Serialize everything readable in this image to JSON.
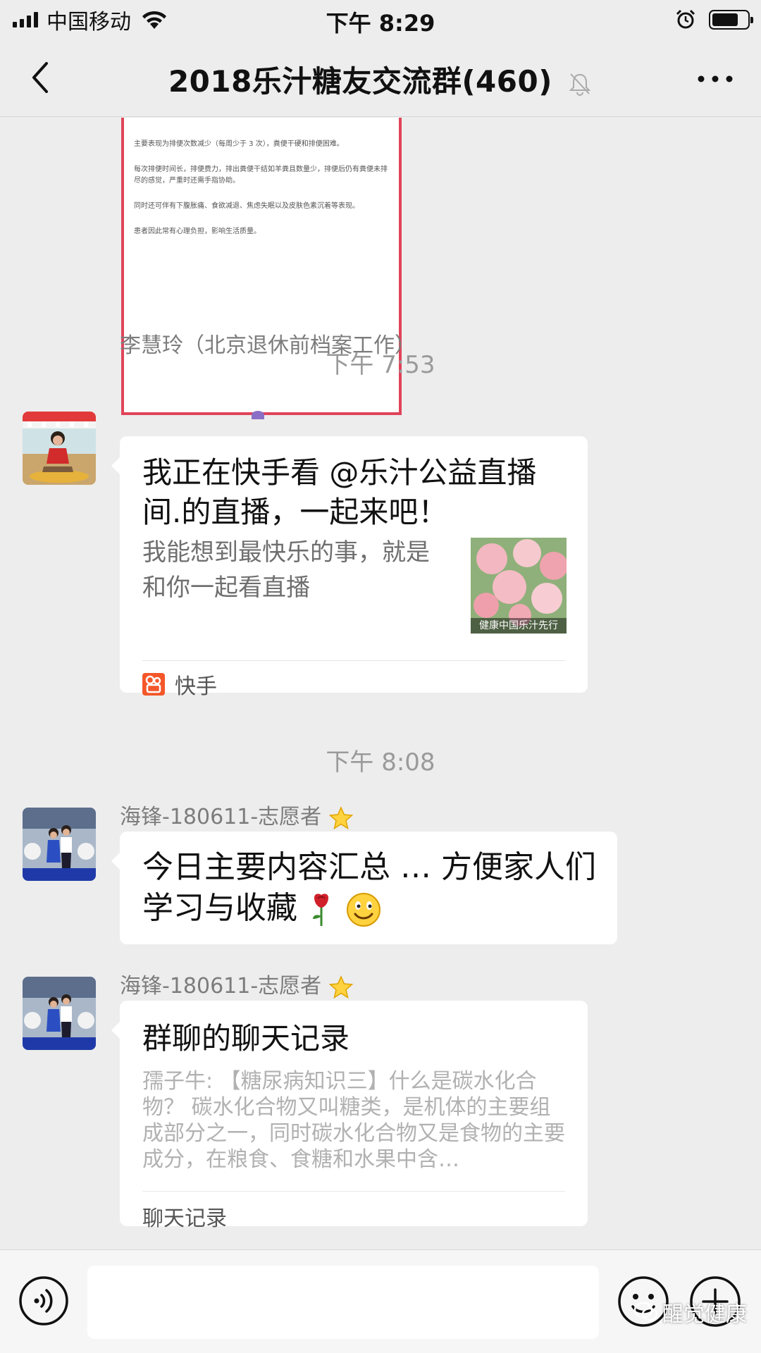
{
  "status_bar": {
    "carrier": "中国移动",
    "time": "下午 8:29",
    "icons": [
      "signal-icon",
      "wifi-icon",
      "alarm-icon",
      "battery-icon"
    ],
    "battery_level": 0.75
  },
  "nav": {
    "title": "2018乐汁糖友交流群(460)",
    "icons": [
      "back-icon",
      "mute-bell-icon",
      "more-icon"
    ]
  },
  "messages": {
    "doc_image": {
      "lines": [
        "主要表现为排便次数减少（每周少于 3 次），粪便干硬和排便困难。",
        "每次排便时间长，排便费力，排出粪便干结如羊粪且数量少，排便后仍有粪便未排尽的感觉，严重时还需手指协助。",
        "同时还可伴有下腹胀痛、食欲减退、焦虑失眠以及皮肤色素沉着等表现。",
        "患者因此常有心理负担，影响生活质量。"
      ]
    },
    "time_1": "下午 7:53",
    "msg_share": {
      "sender": "李慧玲（北京退休前档案工作）",
      "title": "我正在快手看 @乐汁公益直播间.的直播，一起来吧！",
      "desc": "我能想到最快乐的事，就是和你一起看直播",
      "thumb_caption": "健康中国乐汁先行",
      "source": "快手"
    },
    "time_2": "下午 8:08",
    "msg_text": {
      "sender": "海锋-180611-志愿者",
      "text": "今日主要内容汇总 … 方便家人们学习与收藏"
    },
    "msg_history": {
      "sender": "海锋-180611-志愿者",
      "title": "群聊的聊天记录",
      "preview": "孺子牛: 【糖尿病知识三】什么是碳水化合物？ 碳水化合物又叫糖类，是机体的主要组成部分之一，同时碳水化合物又是食物的主要成分，在粮食、食糖和水果中含…",
      "label": "聊天记录"
    }
  },
  "input_bar": {
    "placeholder": "",
    "icons": [
      "voice-icon",
      "emoji-icon",
      "plus-icon"
    ],
    "watermark": "醒觉健康"
  }
}
